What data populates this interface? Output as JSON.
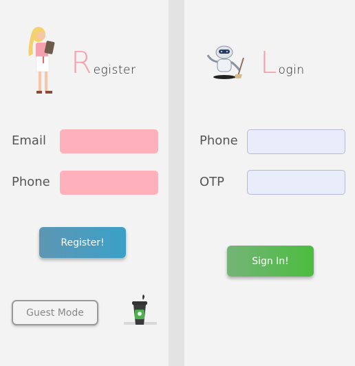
{
  "register": {
    "heading_initial": "R",
    "heading_rest": "egister",
    "email_label": "Email",
    "email_value": "",
    "phone_label": "Phone",
    "phone_value": "",
    "register_button": "Register!",
    "guest_button": "Guest Mode"
  },
  "login": {
    "heading_initial": "L",
    "heading_rest": "ogin",
    "phone_label": "Phone",
    "phone_value": "",
    "otp_label": "OTP",
    "otp_value": "",
    "signin_button": "Sign In!"
  },
  "colors": {
    "background": "#e3e3e3",
    "panel": "#f3f3f3",
    "accent_pink": "#f6a0ad",
    "input_pink": "#ffb0bb",
    "input_lavender": "#e8ecfb",
    "register_blue": "#3aa0c8",
    "signin_green": "#4bbd3e"
  },
  "icons": {
    "register_illustration": "woman-with-notepad-illustration",
    "login_illustration": "robot-sweeping-illustration",
    "guest_illustration": "coffee-cup-illustration"
  }
}
